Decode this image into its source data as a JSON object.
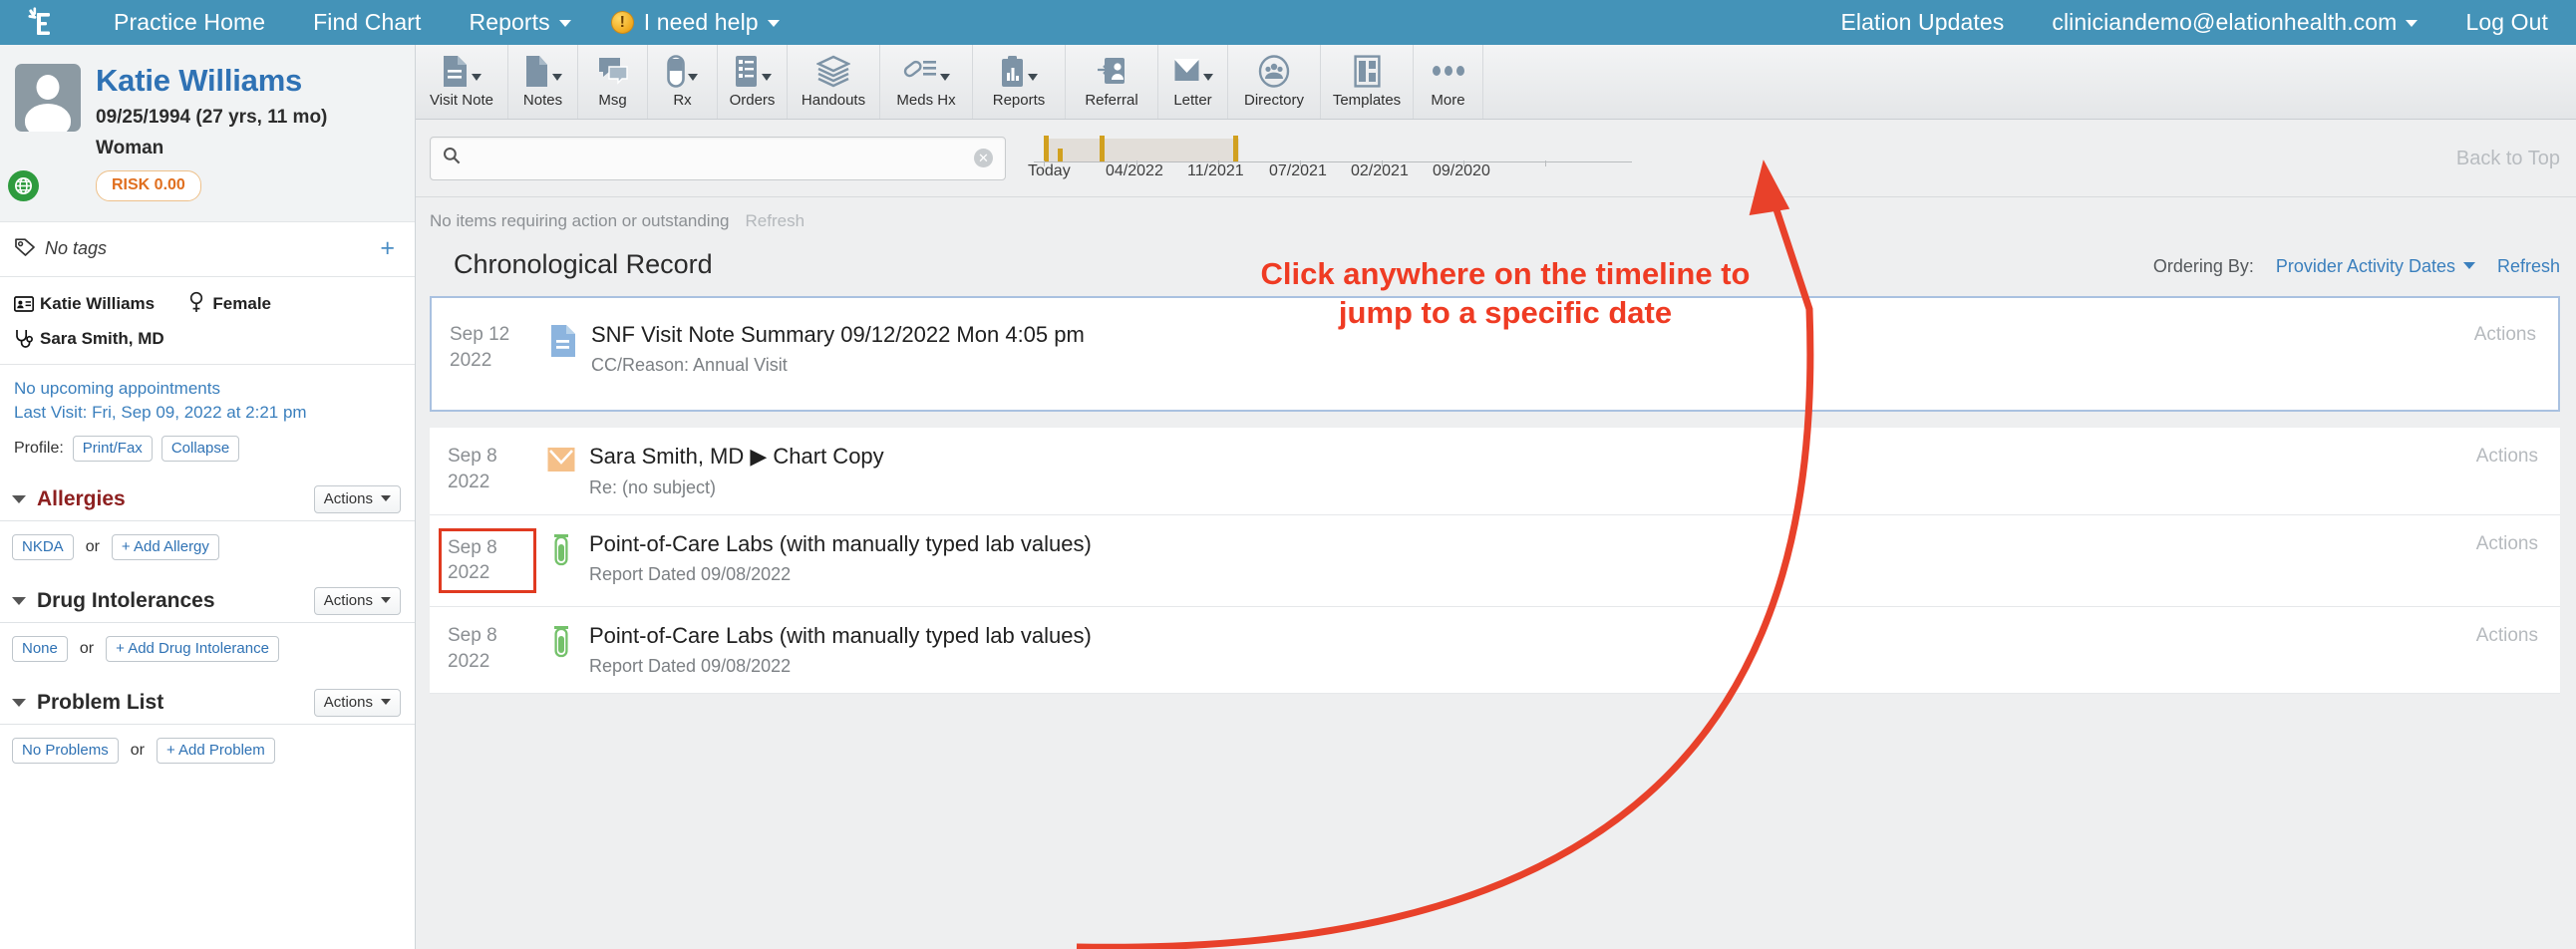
{
  "topnav": {
    "logo_icon": "elation-logo-icon",
    "links": [
      {
        "label": "Practice Home",
        "icon": null,
        "caret": false
      },
      {
        "label": "Find Chart",
        "icon": null,
        "caret": false
      },
      {
        "label": "Reports",
        "icon": null,
        "caret": true
      }
    ],
    "help": {
      "label": "I need help",
      "icon": "alert-exclamation-icon",
      "caret": true
    },
    "right": [
      {
        "label": "Elation Updates",
        "caret": false
      },
      {
        "label": "cliniciandemo@elationhealth.com",
        "caret": true
      },
      {
        "label": "Log Out",
        "caret": false
      }
    ],
    "bg_color": "#4493b8"
  },
  "sidebar": {
    "patient": {
      "name": "Katie Williams",
      "dob_line": "09/25/1994 (27 yrs, 11 mo)",
      "gender_label": "Woman",
      "risk_badge": "RISK 0.00",
      "risk_color": "#e06f1f",
      "avatar_icon": "patient-avatar-icon",
      "globe_icon": "globe-icon"
    },
    "tags": {
      "label": "No tags",
      "tag_icon": "tag-icon",
      "add_icon": "plus-icon"
    },
    "identity": {
      "name": "Katie Williams",
      "name_icon": "id-card-icon",
      "sex": "Female",
      "sex_icon": "female-symbol-icon",
      "provider": "Sara Smith, MD",
      "provider_icon": "stethoscope-icon"
    },
    "appointments": {
      "upcoming": "No upcoming appointments",
      "last_visit": "Last Visit: Fri, Sep 09, 2022 at 2:21 pm",
      "profile_label": "Profile:",
      "print_fax": "Print/Fax",
      "collapse": "Collapse"
    },
    "sections": [
      {
        "title": "Allergies",
        "title_color": "#8d2020",
        "actions_label": "Actions",
        "chips": [
          {
            "label": "NKDA"
          },
          {
            "label": "or",
            "plain": true
          },
          {
            "label": "+ Add Allergy"
          }
        ]
      },
      {
        "title": "Drug Intolerances",
        "title_color": "#2b2b2b",
        "actions_label": "Actions",
        "chips": [
          {
            "label": "None"
          },
          {
            "label": "or",
            "plain": true
          },
          {
            "label": "+ Add Drug Intolerance"
          }
        ]
      },
      {
        "title": "Problem List",
        "title_color": "#2b2b2b",
        "actions_label": "Actions",
        "chips": [
          {
            "label": "No Problems"
          },
          {
            "label": "or",
            "plain": true
          },
          {
            "label": "+ Add Problem"
          }
        ]
      }
    ]
  },
  "toolbar": {
    "items": [
      {
        "label": "Visit Note",
        "icon": "document-lines-icon",
        "caret": true,
        "wide": true
      },
      {
        "label": "Notes",
        "icon": "document-blank-icon",
        "caret": true
      },
      {
        "label": "Msg",
        "icon": "speech-bubble-icon",
        "caret": false
      },
      {
        "label": "Rx",
        "icon": "pill-capsule-icon",
        "caret": true
      },
      {
        "label": "Orders",
        "icon": "clipboard-list-icon",
        "caret": true
      },
      {
        "label": "Handouts",
        "icon": "stacked-layers-icon",
        "caret": false,
        "wide": true
      },
      {
        "label": "Meds Hx",
        "icon": "pill-history-icon",
        "caret": true,
        "wide": true
      },
      {
        "label": "Reports",
        "icon": "chart-clipboard-icon",
        "caret": true,
        "wide": true
      },
      {
        "label": "Referral",
        "icon": "referral-person-icon",
        "caret": false,
        "wide": true
      },
      {
        "label": "Letter",
        "icon": "envelope-icon",
        "caret": true
      },
      {
        "label": "Directory",
        "icon": "directory-people-icon",
        "caret": false,
        "wide": true
      },
      {
        "label": "Templates",
        "icon": "templates-layout-icon",
        "caret": false,
        "wide": true
      },
      {
        "label": "More",
        "icon": "ellipsis-icon",
        "caret": false
      }
    ]
  },
  "search": {
    "value": "",
    "placeholder": "",
    "search_icon": "search-icon",
    "clear_icon": "clear-circle-icon"
  },
  "timeline": {
    "labels": [
      "Today",
      "04/2022",
      "11/2021",
      "07/2021",
      "02/2021",
      "09/2020"
    ],
    "back_to_top": "Back to Top",
    "marker_color": "#d1a01f",
    "band_color": "#e2ded9"
  },
  "status": {
    "message": "No items requiring action or outstanding",
    "refresh_label": "Refresh"
  },
  "record_header": {
    "title": "Chronological Record",
    "ordering_label": "Ordering By:",
    "ordering_value": "Provider Activity Dates",
    "refresh_label": "Refresh"
  },
  "annotation": {
    "text": "Click anywhere on the timeline to jump to a specific date",
    "color": "#ef3b23"
  },
  "records": [
    {
      "date_day": "Sep 12",
      "date_year": "2022",
      "icon": "visit-note-document-icon",
      "icon_color": "#8cb4de",
      "title": "SNF Visit Note Summary 09/12/2022 Mon 4:05 pm",
      "subtitle": "CC/Reason: Annual Visit",
      "actions_label": "Actions",
      "selected": true,
      "date_boxed": false
    },
    {
      "date_day": "Sep 8",
      "date_year": "2022",
      "icon": "envelope-message-icon",
      "icon_color": "#f5c089",
      "title": "Sara Smith, MD ▶ Chart Copy",
      "subtitle": "Re: (no subject)",
      "actions_label": "Actions",
      "selected": false,
      "date_boxed": false
    },
    {
      "date_day": "Sep 8",
      "date_year": "2022",
      "icon": "lab-test-tube-icon",
      "icon_color": "#74c16a",
      "title": "Point-of-Care Labs (with manually typed lab values)",
      "subtitle": "Report Dated 09/08/2022",
      "actions_label": "Actions",
      "selected": false,
      "date_boxed": true
    },
    {
      "date_day": "Sep 8",
      "date_year": "2022",
      "icon": "lab-test-tube-icon",
      "icon_color": "#74c16a",
      "title": "Point-of-Care Labs (with manually typed lab values)",
      "subtitle": "Report Dated 09/08/2022",
      "actions_label": "Actions",
      "selected": false,
      "date_boxed": false
    }
  ]
}
